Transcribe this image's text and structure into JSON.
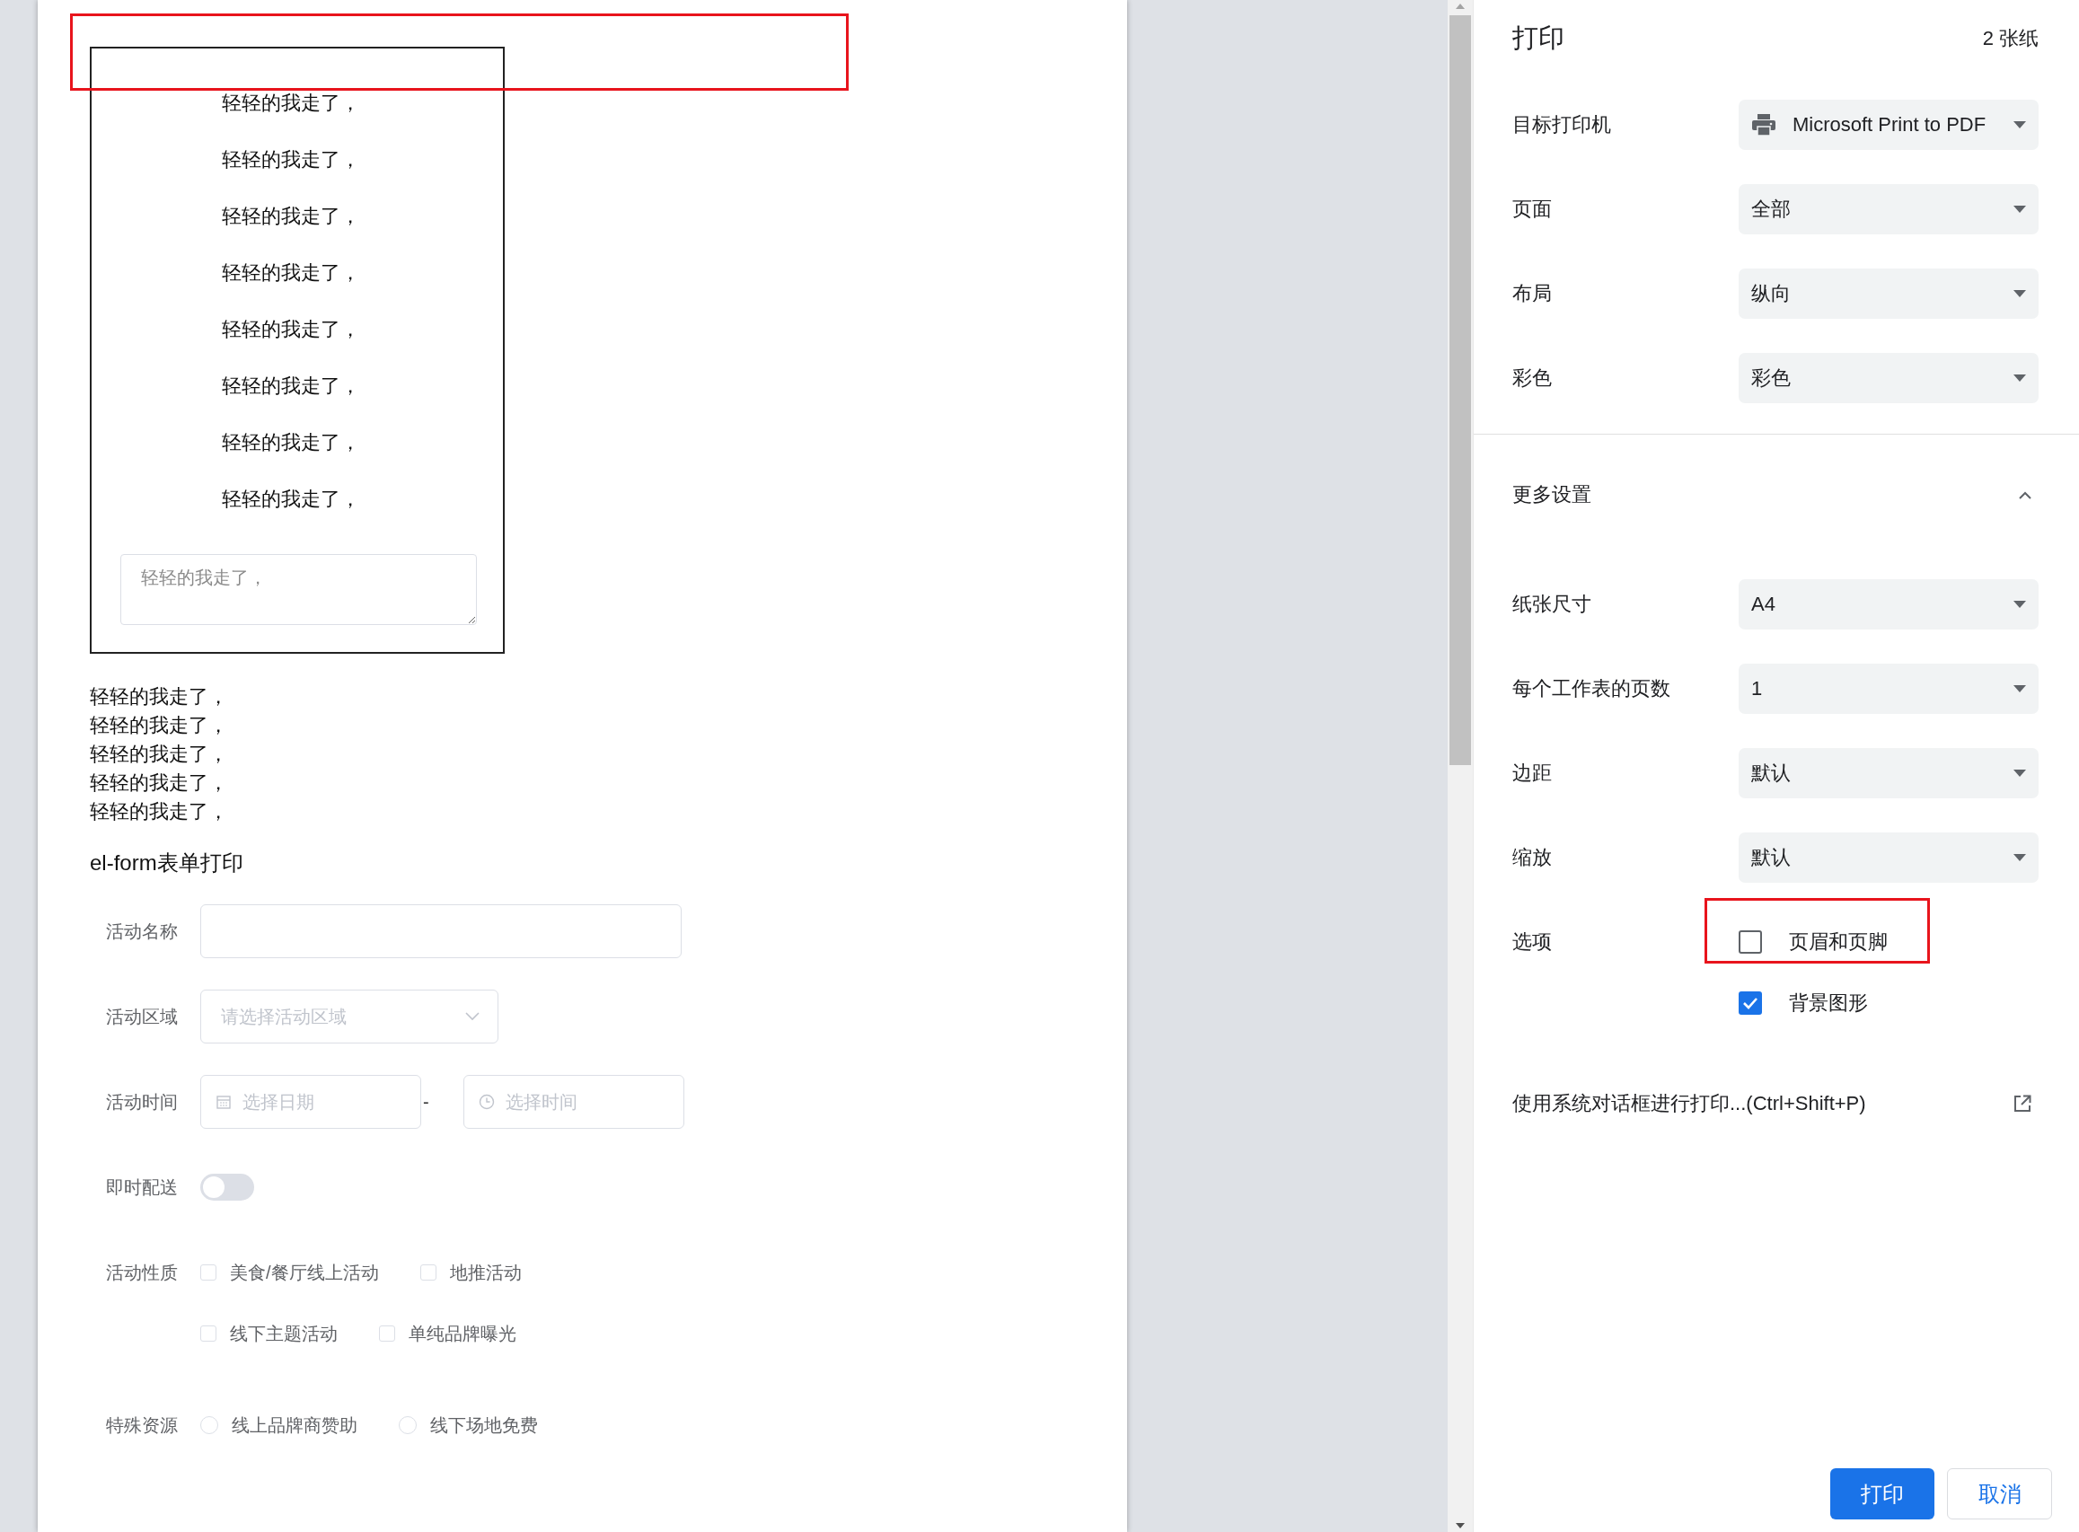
{
  "preview": {
    "header_highlight": true,
    "bordered_block": {
      "lines": [
        "轻轻的我走了，",
        "轻轻的我走了，",
        "轻轻的我走了，",
        "轻轻的我走了，",
        "轻轻的我走了，",
        "轻轻的我走了，",
        "轻轻的我走了，",
        "轻轻的我走了，"
      ],
      "textarea": {
        "placeholder": "轻轻的我走了，"
      }
    },
    "plain_lines": [
      "轻轻的我走了，",
      "轻轻的我走了，",
      "轻轻的我走了，",
      "轻轻的我走了，",
      "轻轻的我走了，"
    ],
    "form": {
      "title": "el-form表单打印",
      "fields": [
        {
          "kind": "text",
          "label": "活动名称"
        },
        {
          "kind": "select",
          "label": "活动区域",
          "placeholder": "请选择活动区域"
        },
        {
          "kind": "datetime",
          "label": "活动时间",
          "date_placeholder": "选择日期",
          "separator": "-",
          "time_placeholder": "选择时间"
        },
        {
          "kind": "switch",
          "label": "即时配送",
          "on": false
        },
        {
          "kind": "checkboxes",
          "label": "活动性质",
          "options": [
            {
              "label": "美食/餐厅线上活动",
              "checked": false
            },
            {
              "label": "地推活动",
              "checked": false
            },
            {
              "label": "线下主题活动",
              "checked": false
            },
            {
              "label": "单纯品牌曝光",
              "checked": false
            }
          ]
        },
        {
          "kind": "radios",
          "label": "特殊资源",
          "options": [
            {
              "label": "线上品牌商赞助",
              "selected": false
            },
            {
              "label": "线下场地免费",
              "selected": false
            }
          ]
        }
      ]
    }
  },
  "print_panel": {
    "title": "打印",
    "sheet_count": "2 张纸",
    "settings": [
      {
        "label": "目标打印机",
        "kind": "printer",
        "value": "Microsoft Print to PDF"
      },
      {
        "label": "页面",
        "kind": "dropdown",
        "value": "全部"
      },
      {
        "label": "布局",
        "kind": "dropdown",
        "value": "纵向"
      },
      {
        "label": "彩色",
        "kind": "dropdown",
        "value": "彩色"
      }
    ],
    "more_settings": {
      "label": "更多设置",
      "expanded": true
    },
    "more": [
      {
        "label": "纸张尺寸",
        "kind": "dropdown",
        "value": "A4"
      },
      {
        "label": "每个工作表的页数",
        "kind": "dropdown",
        "value": "1"
      },
      {
        "label": "边距",
        "kind": "dropdown",
        "value": "默认"
      },
      {
        "label": "缩放",
        "kind": "dropdown",
        "value": "默认"
      }
    ],
    "options": {
      "label": "选项",
      "items": [
        {
          "label": "页眉和页脚",
          "checked": false,
          "highlighted": true
        },
        {
          "label": "背景图形",
          "checked": true,
          "highlighted": false
        }
      ]
    },
    "system_dialog": "使用系统对话框进行打印...(Ctrl+Shift+P)",
    "buttons": [
      {
        "label": "打印",
        "kind": "primary"
      },
      {
        "label": "取消",
        "kind": "secondary"
      }
    ]
  }
}
